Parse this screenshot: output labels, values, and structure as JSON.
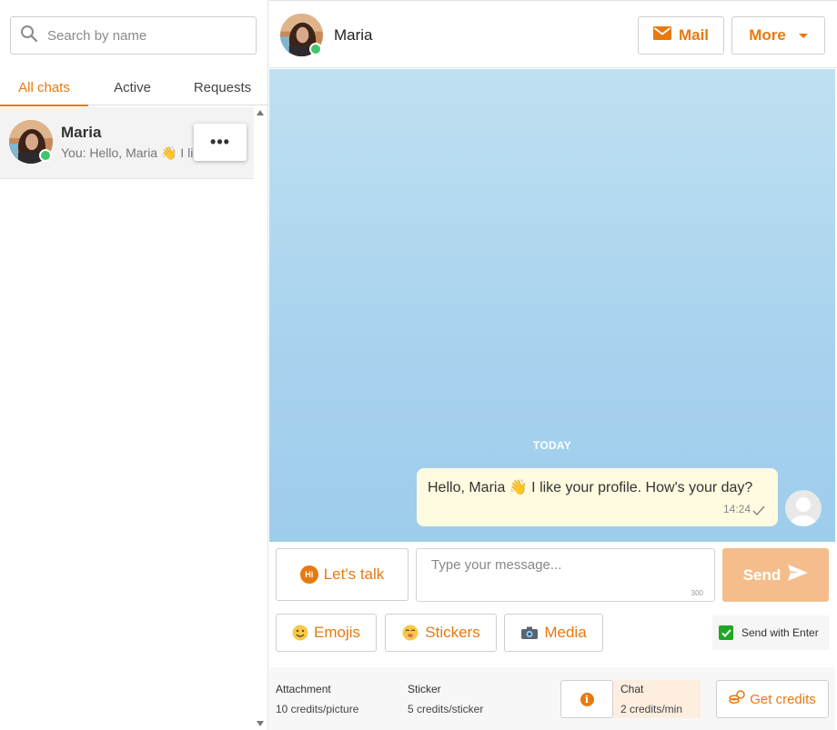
{
  "sidebar": {
    "search": {
      "placeholder": "Search by name",
      "icon": "search-icon"
    },
    "tabs": [
      {
        "label": "All chats",
        "active": true
      },
      {
        "label": "Active",
        "active": false
      },
      {
        "label": "Requests",
        "active": false
      }
    ],
    "chats": [
      {
        "name": "Maria",
        "preview": "You: Hello, Maria 👋 I like your profile",
        "online": true,
        "menu_label": "•••"
      }
    ]
  },
  "header": {
    "name": "Maria",
    "online": true,
    "mail_label": "Mail",
    "more_label": "More"
  },
  "conversation": {
    "date_divider": "TODAY",
    "messages": [
      {
        "text": "Hello, Maria 👋 I like your profile. How's your day?",
        "time": "14:24",
        "status": "sent"
      }
    ]
  },
  "composer": {
    "lets_talk_label": "Let's talk",
    "hi_badge": "Hi",
    "placeholder": "Type your message...",
    "char_limit": "300",
    "send_label": "Send",
    "emojis_label": "Emojis",
    "stickers_label": "Stickers",
    "media_label": "Media",
    "send_with_enter_label": "Send with Enter",
    "send_with_enter_checked": true
  },
  "footer": {
    "attachment_label": "Attachment",
    "attachment_price": "10 credits/picture",
    "sticker_label": "Sticker",
    "sticker_price": "5 credits/sticker",
    "info_icon": "i",
    "chat_label": "Chat",
    "chat_price": "2 credits/min",
    "get_credits_label": "Get credits"
  },
  "colors": {
    "accent": "#e8790f",
    "online": "#3fc56b",
    "bubble": "#fffbe0",
    "send_disabled": "#f6bd8c",
    "chat_bg_top": "#c0e0f1",
    "chat_bg_bottom": "#9ecdec"
  }
}
